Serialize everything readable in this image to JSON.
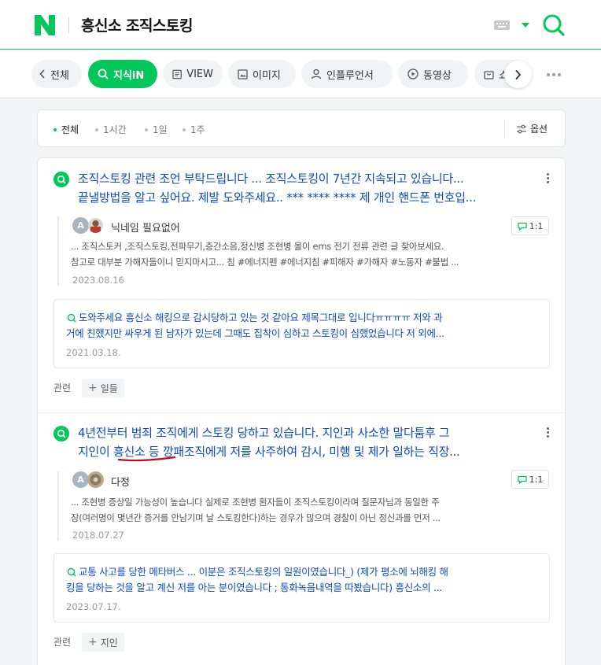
{
  "header": {
    "search_query": "흥신소 조직스토킹"
  },
  "tabs": [
    {
      "label": "전체",
      "icon": "chevron-left-icon"
    },
    {
      "label": "지식iN",
      "icon": "search-icon",
      "active": true
    },
    {
      "label": "VIEW",
      "icon": "document-icon"
    },
    {
      "label": "이미지",
      "icon": "image-icon"
    },
    {
      "label": "인플루언서",
      "icon": "person-icon"
    },
    {
      "label": "동영상",
      "icon": "play-icon"
    },
    {
      "label": "쇼",
      "icon": "bag-icon"
    }
  ],
  "filters": {
    "items": [
      "전체",
      "1시간",
      "1일",
      "1주"
    ],
    "active": "전체",
    "option_label": "옵션"
  },
  "results": [
    {
      "title_line1": "조직스토킹 관련 조언 부탁드립니다 ... 조직스토킹이 7년간 지속되고 있습니다...",
      "title_line2": "끝낼방법을 알고 싶어요. 제발 도와주세요.. *** **** **** 제 개인 핸드폰 번호입...",
      "nickname": "닉네임 필요없어",
      "chat_label": "1:1",
      "snippet_line1": "... 조직스토커 ,조직스토킹,전파무기,층간소음,정신병 조현병 몰이 ems 전기 전류 관련 글 찾아보세요.",
      "snippet_line2": "참고로 대부분 가해자들이니 믿지마시고... 침 #에너지펜 #에너지침 #피해자 #가해자 #노동자 #불법 ...",
      "date": "2023.08.16",
      "related_line1": "도와주세요 흥신소 해킹으로 감시당하고 있는 것 같아요 제목그대로 입니다ㅠㅠㅠㅠ 저와 과",
      "related_line2": "거에 친했지만 싸우게 된 남자가 있는데 그때도 집착이 심하고 스토킹이 심했었습니다 저 외에...",
      "related_date": "2021.03.18.",
      "related_label": "관련",
      "related_chip": "일들"
    },
    {
      "title_line1": "4년전부터 범죄 조직에게 스토킹 당하고 있습니다. 지인과 사소한 말다툼후 그",
      "title_line2": "지인이 흥신소 등 깡패조직에게 저를 사주하여 감시, 미행 및 제가 일하는 직장...",
      "nickname": "다정",
      "chat_label": "1:1",
      "snippet_line1": "... 조현병 증상일 가능성이 높습니다 실제로 조현병 환자들이 조직스토킹이라며 질문자님과 동일한 주",
      "snippet_line2": "장(여러명이 몇년간 증거를 안남기며 날 스토킹한다)하는 경우가 많으며 경찰이 아닌 정신과를 먼저 ...",
      "date": "2018.07.27",
      "related_line1": "교통 사고를 당한 메타버스 ... 이분은 조직스토킹의 일원이였습니다_) (제가 평소에 뇌해킹 해",
      "related_line2": "킹을 당하는 것을 알고 계신 저를 아는 분이였습니다 ; 통화녹음내역을 따봤습니다) 흥신소의 ...",
      "related_date": "2023.07.17.",
      "related_label": "관련",
      "related_chip": "지인"
    }
  ],
  "colors": {
    "brand_green": "#03c75a",
    "link_blue": "#0e4ac4",
    "annotation_red": "#d0021b"
  }
}
